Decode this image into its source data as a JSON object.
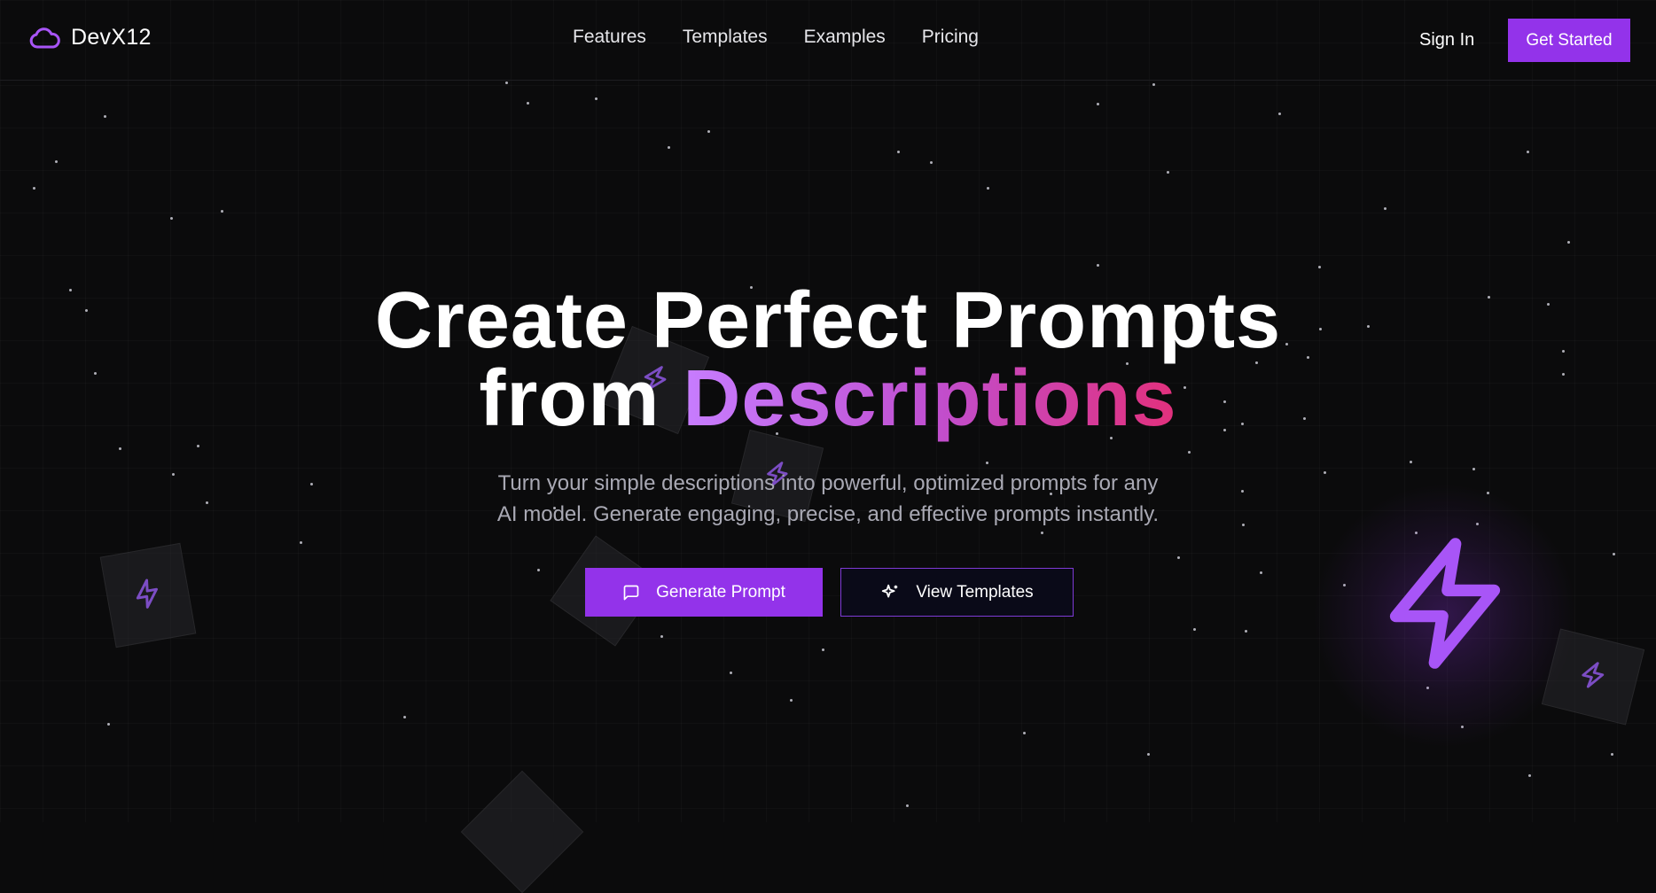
{
  "header": {
    "brand": "DevX12",
    "nav": [
      "Features",
      "Templates",
      "Examples",
      "Pricing"
    ],
    "sign_in": "Sign In",
    "get_started": "Get Started"
  },
  "hero": {
    "title_line1": "Create Perfect Prompts",
    "title_line2_plain": "from ",
    "title_line2_gradient": "Descriptions",
    "subtitle_line1": "Turn your simple descriptions into powerful, optimized prompts for any",
    "subtitle_line2": "AI model. Generate engaging, precise, and effective prompts instantly.",
    "primary_button": "Generate Prompt",
    "primary_icon": "message-square-icon",
    "secondary_button": "View Templates",
    "secondary_icon": "sparkles-icon"
  },
  "colors": {
    "background": "#0b0b0c",
    "accent": "#9333ea",
    "gradient_start": "#c77dff",
    "gradient_end": "#e2307c",
    "subtitle": "#a9a9b4"
  },
  "decorations": {
    "icon": "zap-icon"
  }
}
